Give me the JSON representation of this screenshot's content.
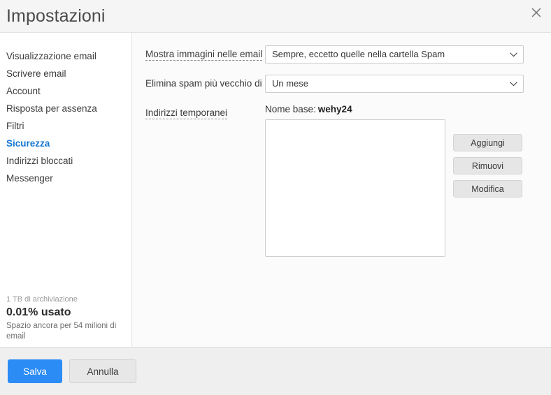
{
  "header": {
    "title": "Impostazioni",
    "close_icon": "close-icon"
  },
  "sidebar": {
    "items": [
      {
        "label": "Visualizzazione email",
        "active": false
      },
      {
        "label": "Scrivere email",
        "active": false
      },
      {
        "label": "Account",
        "active": false
      },
      {
        "label": "Risposta per assenza",
        "active": false
      },
      {
        "label": "Filtri",
        "active": false
      },
      {
        "label": "Sicurezza",
        "active": true
      },
      {
        "label": "Indirizzi bloccati",
        "active": false
      },
      {
        "label": "Messenger",
        "active": false
      }
    ],
    "storage": {
      "quota": "1 TB di archiviazione",
      "used": "0.01% usato",
      "remaining": "Spazio ancora per 54 milioni di email"
    }
  },
  "content": {
    "show_images": {
      "label": "Mostra immagini nelle email",
      "value": "Sempre, eccetto quelle nella cartella Spam",
      "chevron_icon": "chevron-down-icon"
    },
    "delete_spam": {
      "label": "Elimina spam più vecchio di",
      "value": "Un mese",
      "chevron_icon": "chevron-down-icon"
    },
    "temp_addresses": {
      "label": "Indirizzi temporanei",
      "base_name_label": "Nome base:",
      "base_name_value": "wehy24",
      "list_items": [],
      "buttons": {
        "add": "Aggiungi",
        "remove": "Rimuovi",
        "edit": "Modifica"
      }
    }
  },
  "footer": {
    "save_label": "Salva",
    "cancel_label": "Annulla"
  },
  "colors": {
    "accent": "#2b8cf5",
    "active_nav": "#1576d4",
    "header_bg": "#f5f5f5",
    "footer_bg": "#efefef",
    "content_bg": "#fbfbfb"
  }
}
